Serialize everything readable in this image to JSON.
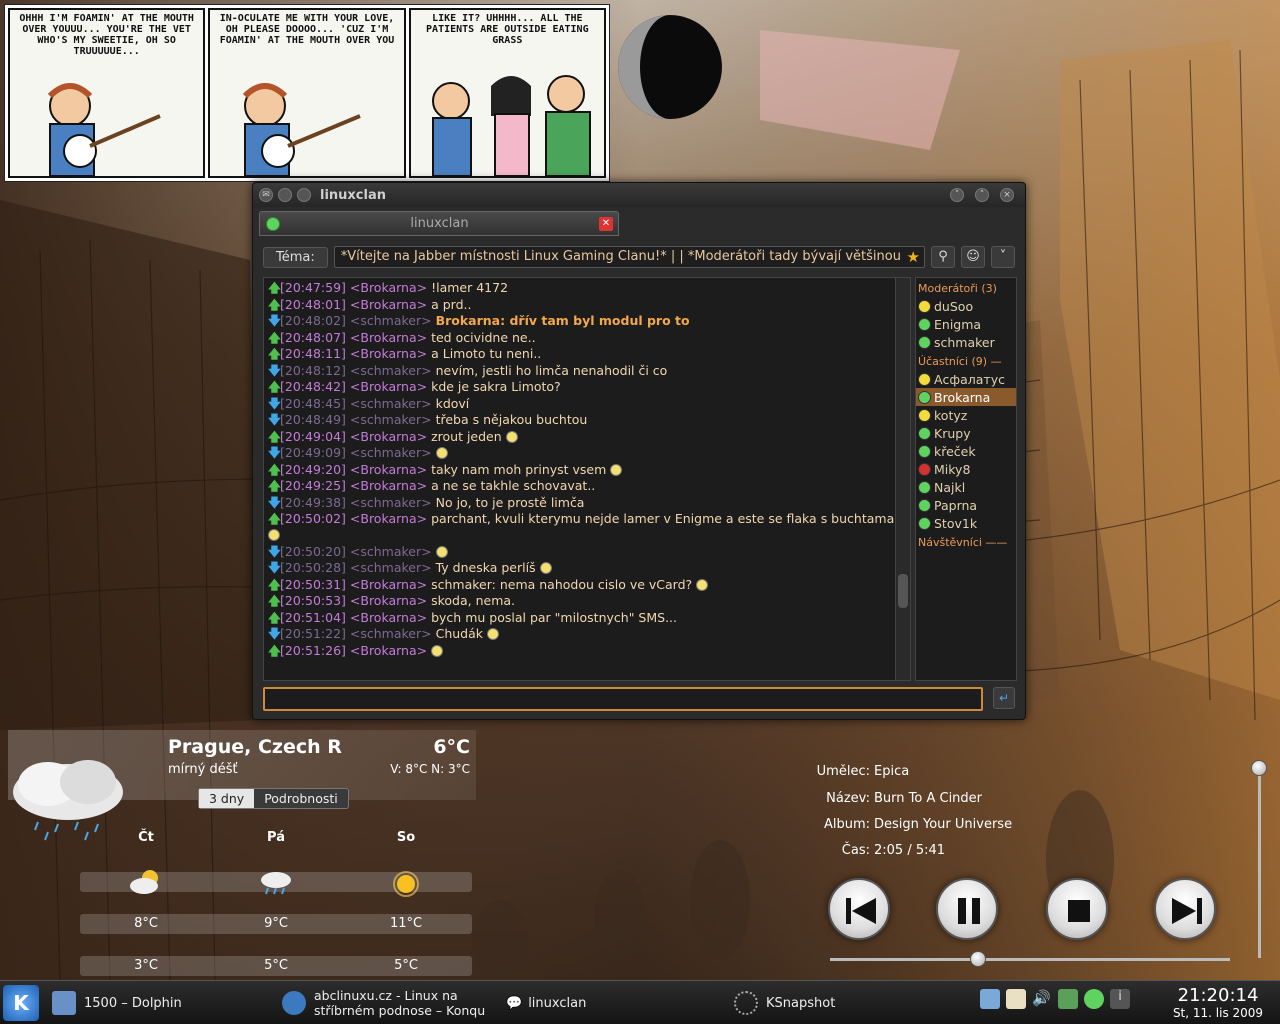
{
  "comic": {
    "panels": [
      {
        "text": "OHHH I'M FOAMIN' AT THE MOUTH OVER YOUUU... YOU'RE THE VET WHO'S MY SWEETIE, OH SO TRUUUUUE..."
      },
      {
        "text": "IN-OCULATE ME WITH YOUR LOVE, OH PLEASE DOOOO... 'CUZ I'M FOAMIN' AT THE MOUTH OVER YOU"
      },
      {
        "text": "LIKE IT?   UHHHH...   ALL THE PATIENTS ARE OUTSIDE EATING GRASS"
      }
    ]
  },
  "window": {
    "title": "linuxclan",
    "tab_label": "linuxclan",
    "topic_label": "Téma:",
    "topic": "*Vítejte na Jabber místnosti Linux Gaming Clanu!* | | *Moderátoři tady bývají většinou"
  },
  "messages": [
    {
      "dir": "in",
      "time": "[20:47:59]",
      "nick": "<Brokarna>",
      "text": "!lamer 4172"
    },
    {
      "dir": "in",
      "time": "[20:48:01]",
      "nick": "<Brokarna>",
      "text": "a prd.."
    },
    {
      "dir": "out",
      "time": "[20:48:02]",
      "nick": "<schmaker>",
      "text": "Brokarna: dřív tam byl modul pro to",
      "hl": true
    },
    {
      "dir": "in",
      "time": "[20:48:07]",
      "nick": "<Brokarna>",
      "text": "ted ocividne ne.."
    },
    {
      "dir": "in",
      "time": "[20:48:11]",
      "nick": "<Brokarna>",
      "text": "a Limoto tu neni.."
    },
    {
      "dir": "out",
      "time": "[20:48:12]",
      "nick": "<schmaker>",
      "text": "nevím, jestli ho limča nenahodil či co"
    },
    {
      "dir": "in",
      "time": "[20:48:42]",
      "nick": "<Brokarna>",
      "text": "kde je sakra Limoto?"
    },
    {
      "dir": "out",
      "time": "[20:48:45]",
      "nick": "<schmaker>",
      "text": "kdoví"
    },
    {
      "dir": "out",
      "time": "[20:48:49]",
      "nick": "<schmaker>",
      "text": "třeba s nějakou buchtou"
    },
    {
      "dir": "in",
      "time": "[20:49:04]",
      "nick": "<Brokarna>",
      "text": "zrout jeden",
      "smile": true
    },
    {
      "dir": "out",
      "time": "[20:49:09]",
      "nick": "<schmaker>",
      "text": "",
      "smile": true
    },
    {
      "dir": "in",
      "time": "[20:49:20]",
      "nick": "<Brokarna>",
      "text": "taky nam moh prinyst vsem",
      "smile": true
    },
    {
      "dir": "in",
      "time": "[20:49:25]",
      "nick": "<Brokarna>",
      "text": "a ne se takhle schovavat.."
    },
    {
      "dir": "out",
      "time": "[20:49:38]",
      "nick": "<schmaker>",
      "text": "No jo, to je prostě limča"
    },
    {
      "dir": "in",
      "time": "[20:50:02]",
      "nick": "<Brokarna>",
      "text": "parchant, kvuli kterymu nejde lamer v Enigme a este se flaka s buchtama",
      "smile": true,
      "wrap": true
    },
    {
      "dir": "out",
      "time": "[20:50:20]",
      "nick": "<schmaker>",
      "text": "",
      "smile": true
    },
    {
      "dir": "out",
      "time": "[20:50:28]",
      "nick": "<schmaker>",
      "text": "Ty dneska perlíš",
      "smile": true
    },
    {
      "dir": "in",
      "time": "[20:50:31]",
      "nick": "<Brokarna>",
      "text": "schmaker: nema nahodou cislo ve vCard?",
      "smile": true
    },
    {
      "dir": "in",
      "time": "[20:50:53]",
      "nick": "<Brokarna>",
      "text": "skoda, nema."
    },
    {
      "dir": "in",
      "time": "[20:51:04]",
      "nick": "<Brokarna>",
      "text": "bych mu poslal par \"milostnych\" SMS..."
    },
    {
      "dir": "out",
      "time": "[20:51:22]",
      "nick": "<schmaker>",
      "text": "Chudák",
      "smile": true
    },
    {
      "dir": "in",
      "time": "[20:51:26]",
      "nick": "<Brokarna>",
      "text": "",
      "smile": true
    }
  ],
  "roster": {
    "groups": [
      {
        "header": "Moderátoři  (3)",
        "members": [
          {
            "name": "duSoo",
            "status": "#f2dc3c"
          },
          {
            "name": "Enigma",
            "status": "#5fd35f"
          },
          {
            "name": "schmaker",
            "status": "#5fd35f"
          }
        ]
      },
      {
        "header": "Účastníci  (9)  —",
        "members": [
          {
            "name": "Асфалатус",
            "status": "#f2dc3c"
          },
          {
            "name": "Brokarna",
            "status": "#5fd35f",
            "selected": true
          },
          {
            "name": "kotyz",
            "status": "#f2dc3c"
          },
          {
            "name": "Krupy",
            "status": "#5fd35f"
          },
          {
            "name": "křeček",
            "status": "#5fd35f"
          },
          {
            "name": "Miky8",
            "status": "#d33030"
          },
          {
            "name": "Najkl",
            "status": "#5fd35f"
          },
          {
            "name": "Paprna",
            "status": "#5fd35f"
          },
          {
            "name": "Stov1k",
            "status": "#5fd35f"
          }
        ]
      },
      {
        "header": "Návštěvníci  ——",
        "members": []
      }
    ]
  },
  "weather": {
    "city": "Prague, Czech R",
    "temp": "6°C",
    "condition": "mírný déšť",
    "hilo": "V: 8°C N: 3°C",
    "tabs": [
      "3 dny",
      "Podrobnosti"
    ],
    "days": [
      {
        "name": "Čt",
        "high": "8°C",
        "low": "3°C"
      },
      {
        "name": "Pá",
        "high": "9°C",
        "low": "5°C"
      },
      {
        "name": "So",
        "high": "11°C",
        "low": "5°C"
      }
    ]
  },
  "player": {
    "artist_label": "Umělec:",
    "artist": "Epica",
    "title_label": "Název:",
    "title": "Burn To A Cinder",
    "album_label": "Album:",
    "album": "Design Your Universe",
    "time_label": "Čas:",
    "time": "2:05 / 5:41",
    "position_fraction": 0.369,
    "volume_fraction": 1.0
  },
  "taskbar": {
    "tasks": [
      {
        "label": "1500 – Dolphin"
      },
      {
        "label": "abclinuxu.cz - Linux na stříbrném podnose – Konqu"
      },
      {
        "label": "linuxclan"
      },
      {
        "label": "KSnapshot"
      }
    ],
    "clock_time": "21:20:14",
    "clock_date": "St, 11. lis 2009"
  }
}
